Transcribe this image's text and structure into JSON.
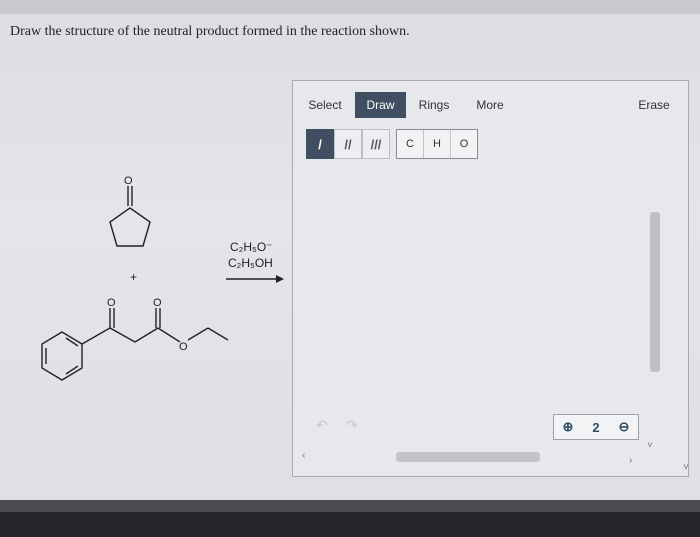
{
  "question": {
    "text": "Draw the structure of the neutral product formed in the reaction shown."
  },
  "reaction": {
    "reagent_line1": "C₂H₅O⁻",
    "reagent_line2": "C₂H₅OH",
    "plus_sign": "+"
  },
  "toolbar": {
    "tabs": [
      {
        "label": "Select",
        "active": false
      },
      {
        "label": "Draw",
        "active": true
      },
      {
        "label": "Rings",
        "active": false
      },
      {
        "label": "More",
        "active": false
      },
      {
        "label": "Erase",
        "active": false
      }
    ],
    "bonds": [
      {
        "symbol": "/",
        "name": "single-bond",
        "selected": true
      },
      {
        "symbol": "//",
        "name": "double-bond",
        "selected": false
      },
      {
        "symbol": "///",
        "name": "triple-bond",
        "selected": false
      }
    ],
    "atoms": [
      "C",
      "H",
      "O"
    ]
  },
  "controls": {
    "undo_icon": "↶",
    "redo_icon": "↷",
    "zoom_in_icon": "⊕",
    "zoom_reset_icon": "2",
    "zoom_out_icon": "⊖",
    "chevron_left": "‹",
    "chevron_right": "›",
    "chevron_down": "˅"
  },
  "colors": {
    "active_tab": "#3f4f61",
    "zoom_icons": "#2e4f66"
  }
}
